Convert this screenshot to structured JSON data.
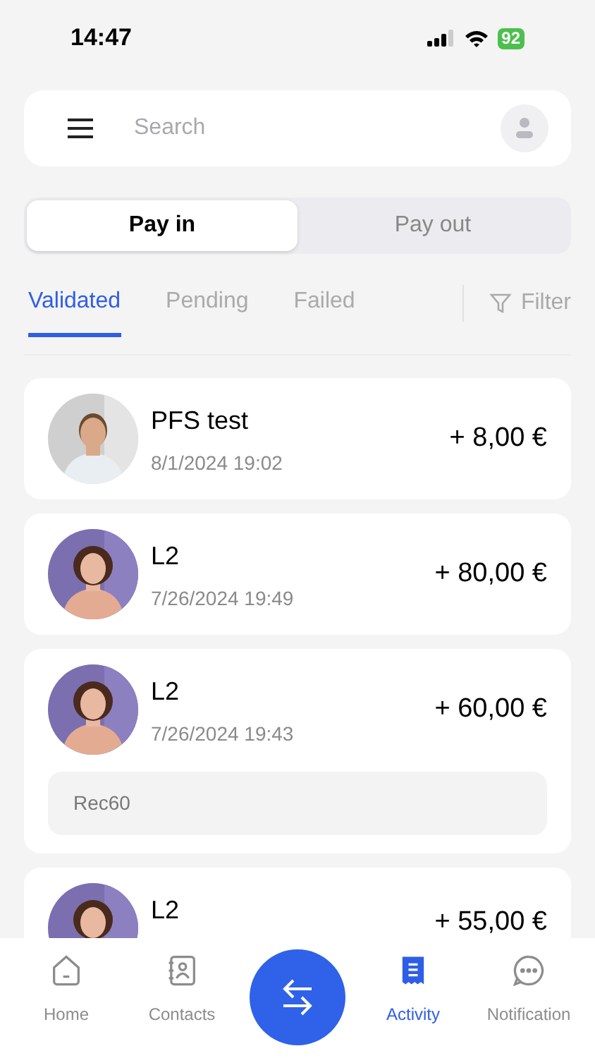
{
  "status_bar": {
    "time": "14:47",
    "battery": "92"
  },
  "header": {
    "search": {
      "placeholder": "Search"
    }
  },
  "segments": [
    {
      "label": "Pay in",
      "selected": true
    },
    {
      "label": "Pay out",
      "selected": false
    }
  ],
  "tabs": [
    {
      "label": "Validated",
      "selected": true
    },
    {
      "label": "Pending",
      "selected": false
    },
    {
      "label": "Failed",
      "selected": false
    }
  ],
  "filter": {
    "label": "Filter"
  },
  "transactions": [
    {
      "name": "PFS test",
      "date": "8/1/2024 19:02",
      "amount": "+ 8,00 €"
    },
    {
      "name": "L2",
      "date": "7/26/2024 19:49",
      "amount": "+ 80,00 €"
    },
    {
      "name": "L2",
      "date": "7/26/2024 19:43",
      "amount": "+ 60,00 €",
      "note": "Rec60"
    },
    {
      "name": "L2",
      "amount": "+ 55,00 €"
    }
  ],
  "bottom_nav": [
    {
      "kind": "home",
      "label": "Home",
      "selected": false
    },
    {
      "kind": "contacts",
      "label": "Contacts",
      "selected": false
    },
    {
      "kind": "transfer"
    },
    {
      "kind": "activity",
      "label": "Activity",
      "selected": true
    },
    {
      "kind": "chat",
      "label": "Notification",
      "selected": false
    }
  ]
}
